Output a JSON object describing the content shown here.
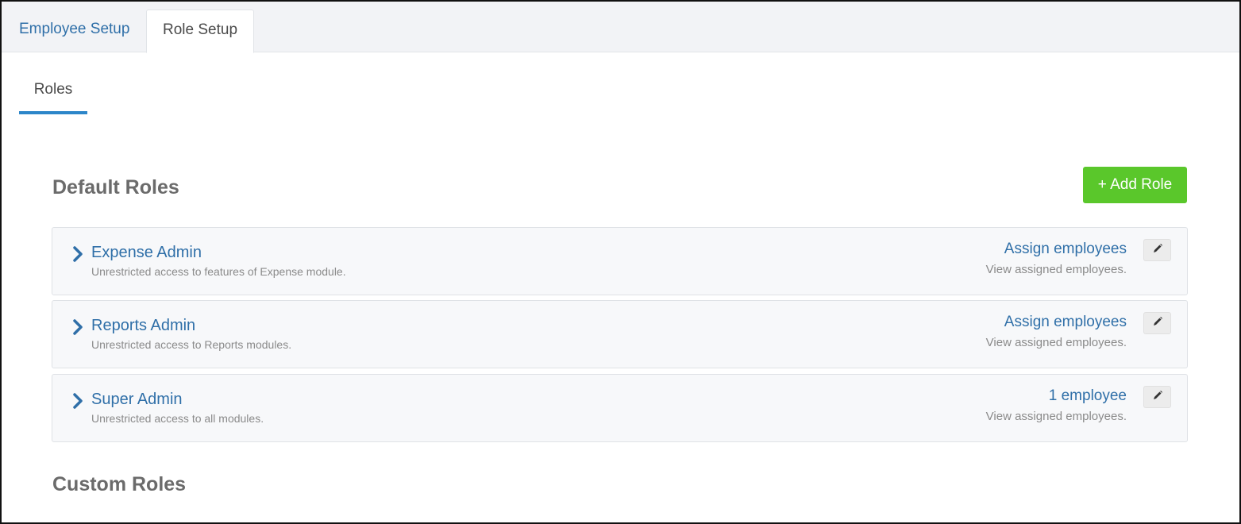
{
  "tabs": {
    "employee_setup": "Employee Setup",
    "role_setup": "Role Setup"
  },
  "subtab": {
    "roles": "Roles"
  },
  "default_roles": {
    "title": "Default Roles",
    "add_button": "+ Add Role",
    "items": [
      {
        "name": "Expense Admin",
        "description": "Unrestricted access to features of Expense module.",
        "assign_label": "Assign employees",
        "view_label": "View assigned employees."
      },
      {
        "name": "Reports Admin",
        "description": "Unrestricted access to Reports modules.",
        "assign_label": "Assign employees",
        "view_label": "View assigned employees."
      },
      {
        "name": "Super Admin",
        "description": "Unrestricted access to all modules.",
        "assign_label": "1 employee",
        "view_label": "View assigned employees."
      }
    ]
  },
  "custom_roles": {
    "title": "Custom Roles"
  },
  "icons": {
    "expand": "chevron-right-icon",
    "edit": "pencil-icon"
  },
  "colors": {
    "link": "#2f6fa8",
    "accent_tab": "#2c86c9",
    "add_button": "#5ac72b"
  }
}
